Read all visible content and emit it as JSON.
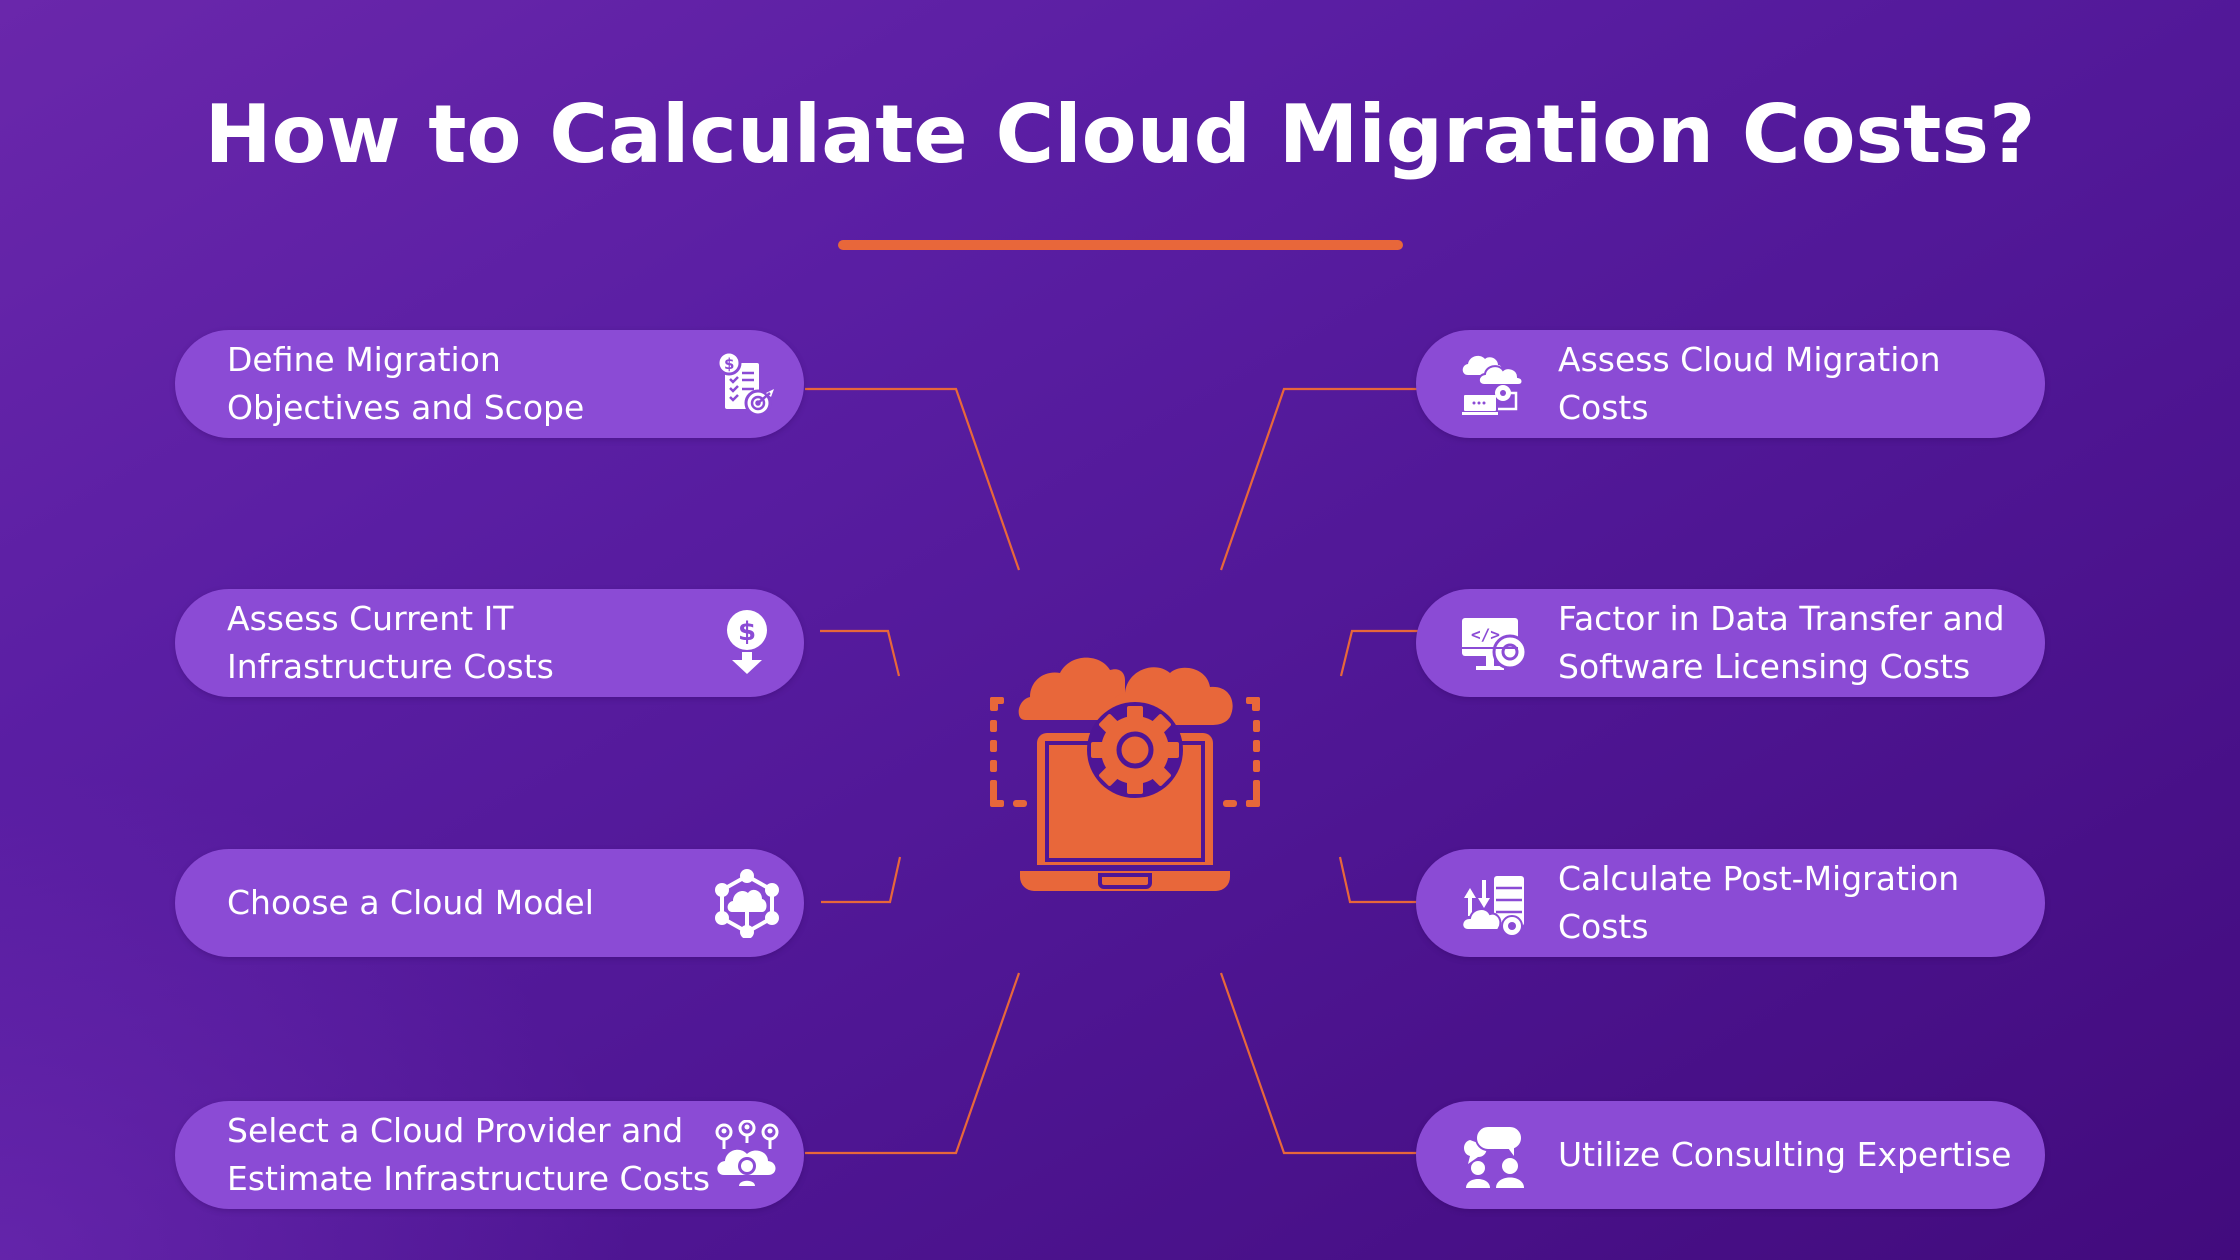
{
  "title": "How to Calculate Cloud Migration Costs?",
  "colors": {
    "accent": "#e8673a",
    "pill": "#8b4bd5",
    "background_start": "#6a27ab",
    "background_end": "#420b7d",
    "text": "#ffffff"
  },
  "center": {
    "icon": "laptop-cloud-gear-icon"
  },
  "left_steps": [
    {
      "label": "Define Migration Objectives and Scope",
      "line1": "Define Migration",
      "line2": "Objectives and Scope",
      "icon": "checklist-dollar-target-icon"
    },
    {
      "label": "Assess Current IT Infrastructure Costs",
      "line1": "Assess Current IT",
      "line2": "Infrastructure Costs",
      "icon": "dollar-down-arrow-icon"
    },
    {
      "label": "Choose a Cloud Model",
      "line1": "Choose a Cloud Model",
      "line2": "",
      "icon": "cloud-network-icon"
    },
    {
      "label": "Select a Cloud Provider and Estimate Infrastructure Costs",
      "line1": "Select a Cloud Provider and",
      "line2": "Estimate Infrastructure Costs",
      "icon": "cloud-users-icon"
    }
  ],
  "right_steps": [
    {
      "label": "Assess Cloud Migration Costs",
      "line1": "Assess Cloud Migration",
      "line2": "Costs",
      "icon": "cloud-laptop-gear-icon"
    },
    {
      "label": "Factor in Data Transfer and Software Licensing Costs",
      "line1": "Factor in Data Transfer and",
      "line2": "Software Licensing Costs",
      "icon": "monitor-code-gear-icon"
    },
    {
      "label": "Calculate Post-Migration Costs",
      "line1": "Calculate Post-Migration",
      "line2": "Costs",
      "icon": "server-cloud-transfer-icon"
    },
    {
      "label": "Utilize Consulting Expertise",
      "line1": "Utilize Consulting Expertise",
      "line2": "",
      "icon": "consulting-chat-people-icon"
    }
  ]
}
